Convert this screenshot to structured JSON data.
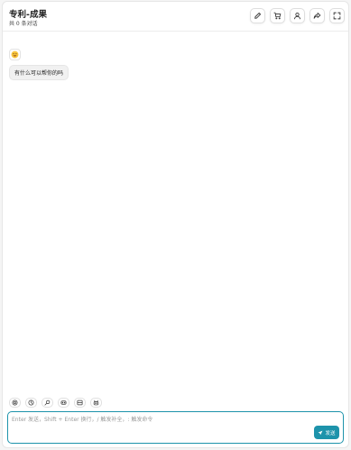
{
  "header": {
    "title": "专利-成果",
    "subtitle": "共 0 条对话",
    "buttons": [
      {
        "name": "edit-icon"
      },
      {
        "name": "cart-icon"
      },
      {
        "name": "user-icon"
      },
      {
        "name": "share-icon"
      },
      {
        "name": "fullscreen-icon"
      }
    ]
  },
  "chat": {
    "messages": [
      {
        "role": "bot",
        "avatar_icon": "smile-emoji-icon",
        "text": "有什么可以帮你的吗"
      }
    ]
  },
  "toolbar": {
    "items": [
      {
        "name": "settings-icon"
      },
      {
        "name": "theme-icon"
      },
      {
        "name": "prompt-icon"
      },
      {
        "name": "mask-icon"
      },
      {
        "name": "layout-icon"
      },
      {
        "name": "robot-icon"
      }
    ]
  },
  "input": {
    "placeholder": "Enter 发送，Shift + Enter 换行，/ 触发补全，: 触发命令",
    "value": ""
  },
  "send_button": {
    "label": "发送"
  },
  "colors": {
    "accent": "#1d93ab",
    "bubble": "#f1f1f1"
  }
}
